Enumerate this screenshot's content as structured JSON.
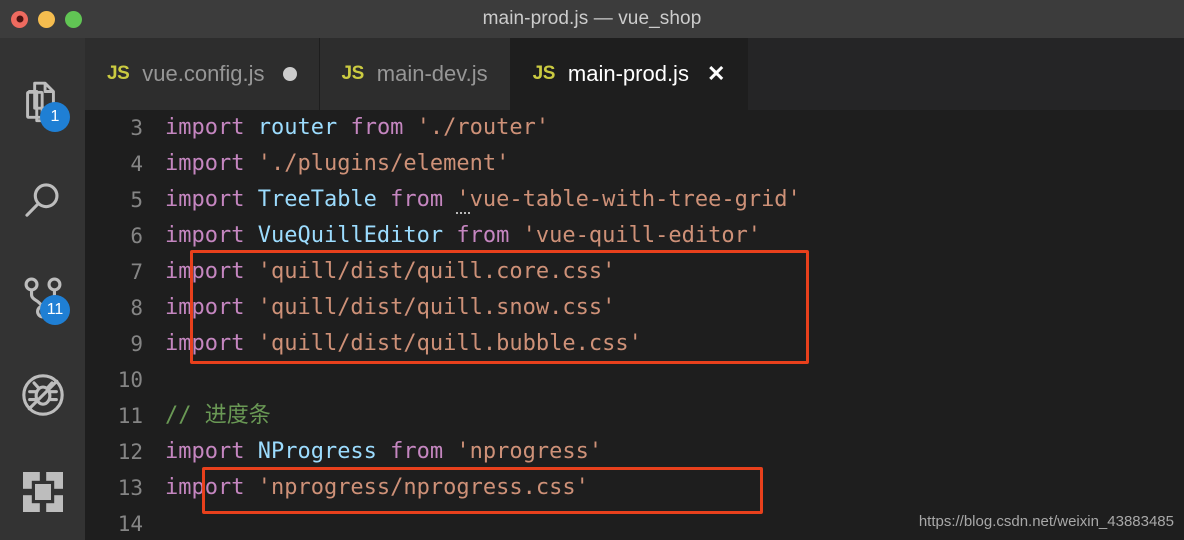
{
  "window": {
    "title": "main-prod.js — vue_shop",
    "traffic_lights": [
      {
        "name": "close",
        "color": "#ee6a5f"
      },
      {
        "name": "minimize",
        "color": "#f5bd4f"
      },
      {
        "name": "maximize",
        "color": "#61c554"
      }
    ]
  },
  "activitybar": {
    "items": [
      {
        "icon": "files-explorer-icon",
        "label": "Explorer",
        "badge": "1"
      },
      {
        "icon": "search-icon",
        "label": "Search",
        "badge": ""
      },
      {
        "icon": "source-control-branch-icon",
        "label": "Source Control",
        "badge": "11"
      },
      {
        "icon": "run-and-debug-disabled-icon",
        "label": "Run and Debug",
        "badge": ""
      },
      {
        "icon": "extensions-icon",
        "label": "Extensions",
        "badge": ""
      }
    ]
  },
  "tabs": [
    {
      "icon_label": "JS",
      "label": "vue.config.js",
      "active": false,
      "dirty": true,
      "closable": false
    },
    {
      "icon_label": "JS",
      "label": "main-dev.js",
      "active": false,
      "dirty": false,
      "closable": false
    },
    {
      "icon_label": "JS",
      "label": "main-prod.js",
      "active": true,
      "dirty": false,
      "closable": true,
      "close_glyph": "✕"
    }
  ],
  "editor": {
    "language": "javascript",
    "first_visible_line": 3,
    "lines": [
      {
        "number": "3",
        "tokens": [
          {
            "t": "import ",
            "c": "kw"
          },
          {
            "t": "router",
            "c": "id"
          },
          {
            "t": " from ",
            "c": "kw"
          },
          {
            "t": "'./router'",
            "c": "str"
          }
        ]
      },
      {
        "number": "4",
        "tokens": [
          {
            "t": "import ",
            "c": "kw"
          },
          {
            "t": "'./plugins/element'",
            "c": "str"
          }
        ]
      },
      {
        "number": "5",
        "tokens": [
          {
            "t": "import ",
            "c": "kw"
          },
          {
            "t": "TreeTable",
            "c": "id"
          },
          {
            "t": " from ",
            "c": "kw"
          },
          {
            "t": "'",
            "c": "str hint"
          },
          {
            "t": "vue-table-with-tree-grid'",
            "c": "str"
          }
        ]
      },
      {
        "number": "6",
        "tokens": [
          {
            "t": "import ",
            "c": "kw"
          },
          {
            "t": "VueQuillEditor",
            "c": "id"
          },
          {
            "t": " from ",
            "c": "kw"
          },
          {
            "t": "'vue-quill-editor'",
            "c": "str"
          }
        ]
      },
      {
        "number": "7",
        "tokens": [
          {
            "t": "import ",
            "c": "kw"
          },
          {
            "t": "'quill/dist/quill.core.css'",
            "c": "str"
          }
        ]
      },
      {
        "number": "8",
        "tokens": [
          {
            "t": "import ",
            "c": "kw"
          },
          {
            "t": "'quill/dist/quill.snow.css'",
            "c": "str"
          }
        ]
      },
      {
        "number": "9",
        "tokens": [
          {
            "t": "import ",
            "c": "kw"
          },
          {
            "t": "'quill/dist/quill.bubble.css'",
            "c": "str"
          }
        ]
      },
      {
        "number": "10",
        "tokens": []
      },
      {
        "number": "11",
        "tokens": [
          {
            "t": "// 进度条",
            "c": "cmt"
          }
        ]
      },
      {
        "number": "12",
        "tokens": [
          {
            "t": "import ",
            "c": "kw"
          },
          {
            "t": "NProgress",
            "c": "id"
          },
          {
            "t": " from ",
            "c": "kw"
          },
          {
            "t": "'nprogress'",
            "c": "str"
          }
        ]
      },
      {
        "number": "13",
        "tokens": [
          {
            "t": "import ",
            "c": "kw"
          },
          {
            "t": "'nprogress/nprogress.css'",
            "c": "str"
          }
        ]
      },
      {
        "number": "14",
        "tokens": []
      }
    ]
  },
  "annotations": [
    {
      "name": "quill-css-imports-highlight",
      "color": "#e8401c",
      "covers_lines": [
        "7",
        "8",
        "9"
      ]
    },
    {
      "name": "nprogress-css-import-highlight",
      "color": "#e8401c",
      "covers_lines": [
        "13"
      ]
    }
  ],
  "watermark": {
    "text": "https://blog.csdn.net/weixin_43883485"
  },
  "theme": {
    "editor_background": "#1e1e1e",
    "activitybar_background": "#333333",
    "tabbar_background": "#252526",
    "titlebar_background": "#3c3c3c",
    "badge_background": "#1f7fd4",
    "keyword_color": "#c586c0",
    "identifier_color": "#9cdcfe",
    "string_color": "#ce9178",
    "comment_color": "#6a9955",
    "linenumber_color": "#858585",
    "annotation_color": "#e8401c"
  }
}
